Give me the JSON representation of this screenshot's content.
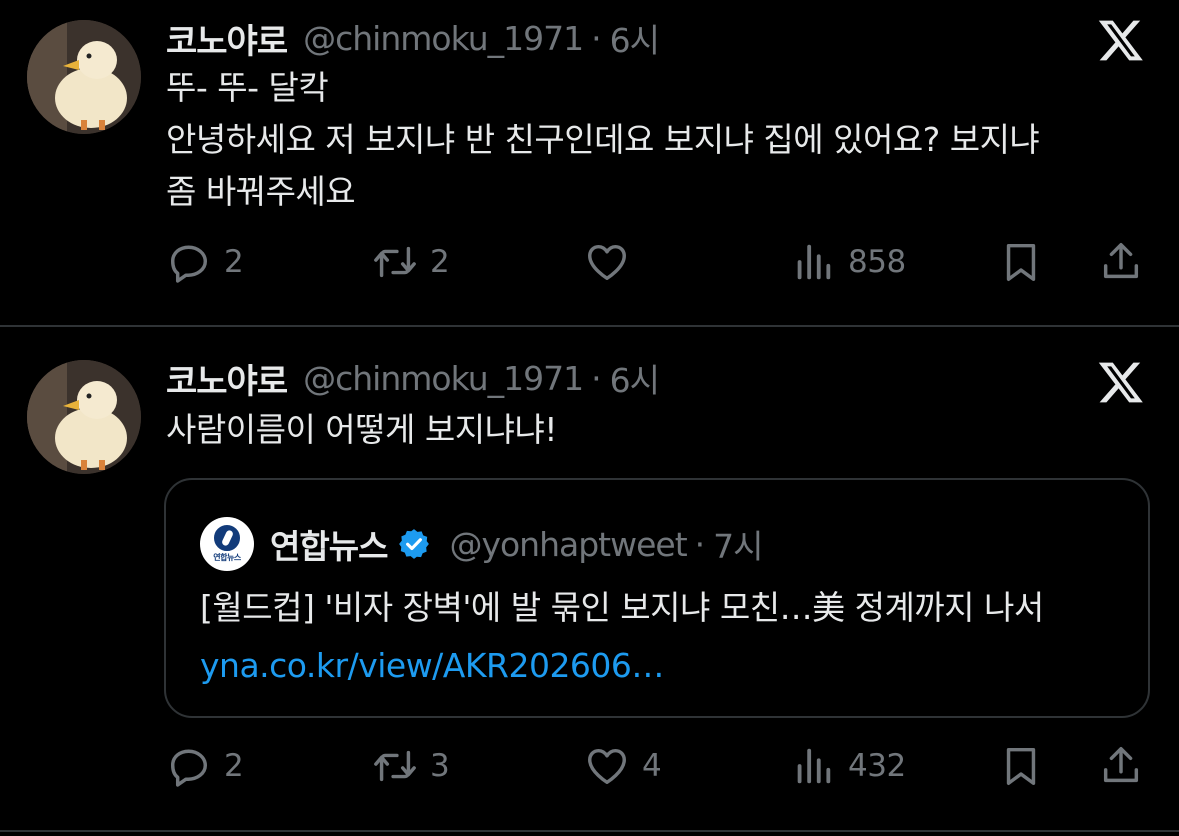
{
  "tweets": [
    {
      "author_name": "코노야로",
      "handle": "@chinmoku_1971",
      "separator": "·",
      "time": "6시",
      "text": "뚜- 뚜- 달칵\n안녕하세요 저 보지냐 반 친구인데요 보지냐 집에 있어요? 보지냐\n좀 바꿔주세요",
      "replies": "2",
      "reposts": "2",
      "likes": "",
      "views": "858"
    },
    {
      "author_name": "코노야로",
      "handle": "@chinmoku_1971",
      "separator": "·",
      "time": "6시",
      "text": "사람이름이 어떻게 보지냐냐!",
      "replies": "2",
      "reposts": "3",
      "likes": "4",
      "views": "432",
      "quote": {
        "logo_text": "연합뉴스",
        "author_name": "연합뉴스",
        "handle": "@yonhaptweet",
        "separator": "·",
        "time": "7시",
        "text": "[월드컵] '비자 장벽'에 발 묶인 보지냐 모친…美 정계까지 나서",
        "link": "yna.co.kr/view/AKR202606…"
      }
    }
  ],
  "colors": {
    "background": "#000000",
    "text": "#e7e9ea",
    "muted": "#71767b",
    "link": "#1d9bf0",
    "divider": "#2f3336",
    "verified": "#1d9bf0"
  },
  "icons": {
    "reply": "reply-icon",
    "repost": "repost-icon",
    "like": "heart-icon",
    "views": "views-icon",
    "bookmark": "bookmark-icon",
    "share": "share-icon",
    "brand": "x-logo-icon"
  }
}
